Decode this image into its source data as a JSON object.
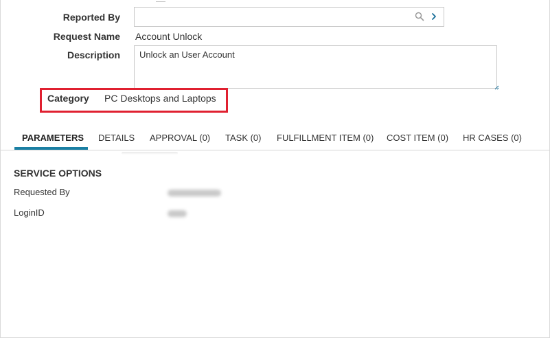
{
  "form": {
    "reported_by_label": "Reported By",
    "reported_by_value": "",
    "request_name_label": "Request Name",
    "request_name_value": "Account Unlock",
    "description_label": "Description",
    "description_value": "Unlock an User Account",
    "category_label": "Category",
    "category_value": "PC Desktops and Laptops"
  },
  "tabs": [
    {
      "label": "PARAMETERS",
      "active": true
    },
    {
      "label": "DETAILS"
    },
    {
      "label": "APPROVAL (0)"
    },
    {
      "label": "TASK (0)"
    },
    {
      "label": "FULFILLMENT ITEM (0)"
    },
    {
      "label": "COST ITEM (0)"
    },
    {
      "label": "HR CASES (0)"
    }
  ],
  "service_options": {
    "title": "SERVICE OPTIONS",
    "requested_by_label": "Requested By",
    "login_id_label": "LoginID"
  },
  "colors": {
    "highlight": "#e02030",
    "active_tab_underline": "#1a7fa3",
    "lookup_chevron": "#1a6f99"
  },
  "icons": {
    "lookup_search": "search-icon",
    "lookup_open": "chevron-right-icon",
    "textarea_resize": "resize-handle-icon"
  }
}
